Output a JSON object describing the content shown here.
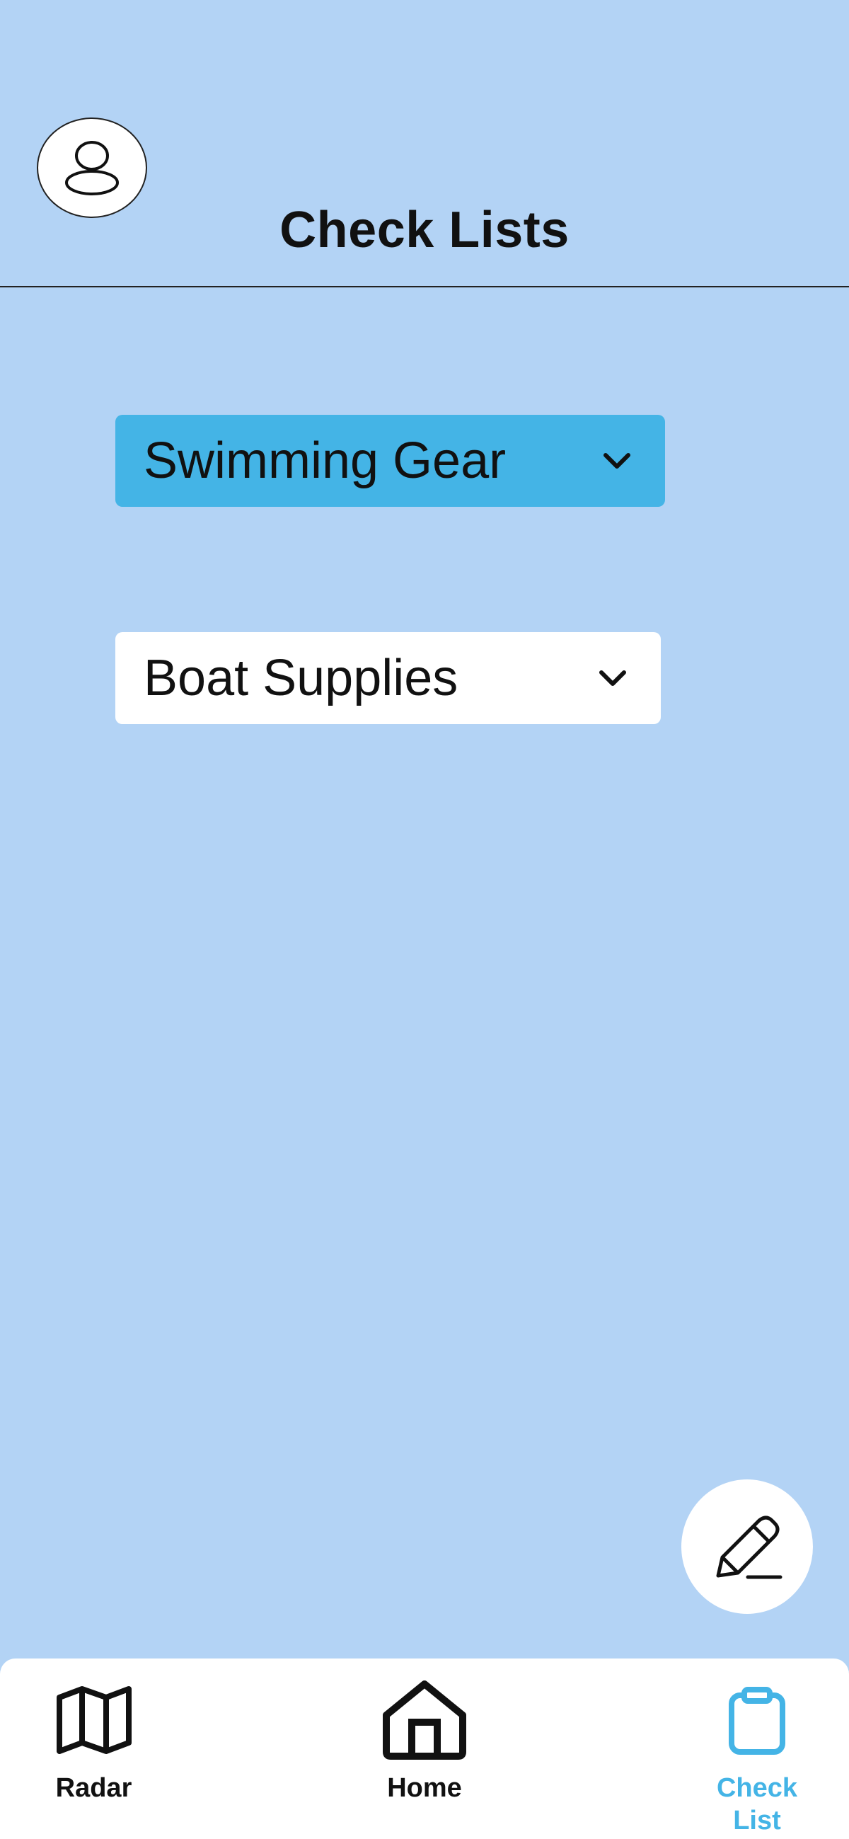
{
  "header": {
    "title": "Check Lists",
    "avatar_icon": "user-icon"
  },
  "lists": [
    {
      "label": "Swimming Gear",
      "selected": true
    },
    {
      "label": "Boat Supplies",
      "selected": false
    }
  ],
  "fab": {
    "icon": "pencil-icon"
  },
  "bottom_nav": {
    "items": [
      {
        "label": "Radar",
        "icon": "map-icon",
        "active": false
      },
      {
        "label": "Home",
        "icon": "home-icon",
        "active": false
      },
      {
        "label_line1": "Check",
        "label_line2": "List",
        "icon": "clipboard-icon",
        "active": true
      }
    ]
  },
  "colors": {
    "background": "#b3d3f5",
    "accent": "#44b4e6",
    "surface": "#ffffff",
    "text": "#111111"
  }
}
